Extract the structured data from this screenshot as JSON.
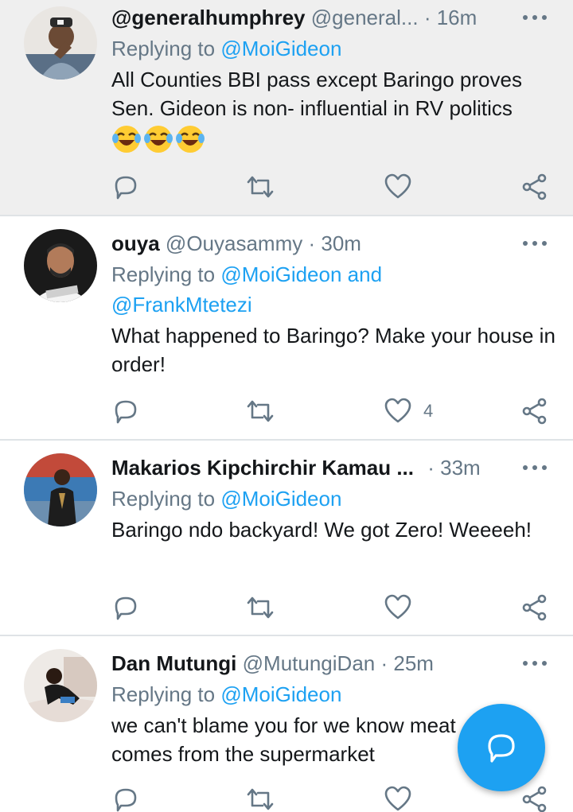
{
  "tweets": [
    {
      "display_name": "@generalhumphrey",
      "handle": "@general...",
      "time": "· 16m",
      "replying_label": "Replying to",
      "mentions": "@MoiGideon",
      "mentions_line2": "",
      "text": "All Counties BBI pass except Baringo proves Sen. Gideon is non- influential in RV politics",
      "emoji": [
        "😂",
        "😂",
        "😂"
      ],
      "like_count": ""
    },
    {
      "display_name": "ouya",
      "handle": "@Ouyasammy",
      "time": "· 30m",
      "replying_label": "Replying to",
      "mentions": "@MoiGideon and",
      "mentions_line2": "@FrankMtetezi",
      "text": "What happened to Baringo? Make your house in order!",
      "emoji": [],
      "like_count": "4"
    },
    {
      "display_name": "Makarios Kipchirchir Kamau ...",
      "handle": "",
      "time": "· 33m",
      "replying_label": "Replying to",
      "mentions": "@MoiGideon",
      "mentions_line2": "",
      "text": "Baringo ndo backyard! We got Zero! Weeeeh!",
      "emoji": [],
      "like_count": ""
    },
    {
      "display_name": "Dan Mutungi",
      "handle": "@MutungiDan",
      "time": "· 25m",
      "replying_label": "Replying to",
      "mentions": "@MoiGideon",
      "mentions_line2": "",
      "text": "we can't  blame you for we know meat comes from the supermarket",
      "emoji": [],
      "like_count": ""
    }
  ],
  "icons": {
    "reply": "reply-icon",
    "retweet": "retweet-icon",
    "like": "heart-icon",
    "share": "share-icon",
    "more": "more-icon",
    "compose": "compose-reply-icon"
  },
  "colors": {
    "accent": "#1da1f2",
    "muted": "#657786",
    "text": "#14171a",
    "highlight_bg": "#efefef",
    "divider": "#dfe3e6"
  }
}
